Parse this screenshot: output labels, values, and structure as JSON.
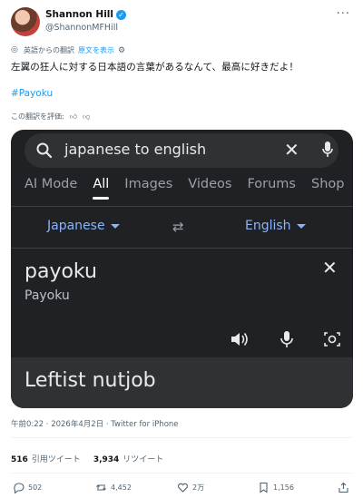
{
  "author": {
    "name": "Shannon Hill",
    "handle": "@ShannonMFHill"
  },
  "translation_bar": {
    "label": "英語からの翻訳",
    "show_original": "原文を表示"
  },
  "tweet": {
    "text": "左翼の狂人に対する日本語の言葉があるなんて、最高に好きだよ！",
    "hashtag": "#Payoku"
  },
  "rate_translation": "この翻訳を評価:",
  "google": {
    "query": "japanese to english",
    "tabs": [
      "AI Mode",
      "All",
      "Images",
      "Videos",
      "Forums",
      "Shop"
    ],
    "active_tab": "All",
    "source_lang": "Japanese",
    "target_lang": "English",
    "source_text": "payoku",
    "source_romanized": "Payoku",
    "result_text": "Leftist nutjob"
  },
  "meta": {
    "timestamp": "午前0:22 · 2026年4月2日 · Twitter for iPhone"
  },
  "stats": {
    "quotes_count": "516",
    "quotes_label": "引用ツイート",
    "retweets_count": "3,934",
    "retweets_label": "リツイート"
  },
  "actions": {
    "replies": "502",
    "retweets": "4,452",
    "likes": "2万",
    "bookmarks": "1,156"
  },
  "colors": {
    "accent": "#1d9bf0",
    "google_bg": "#202124",
    "google_link": "#8ab4f8"
  }
}
